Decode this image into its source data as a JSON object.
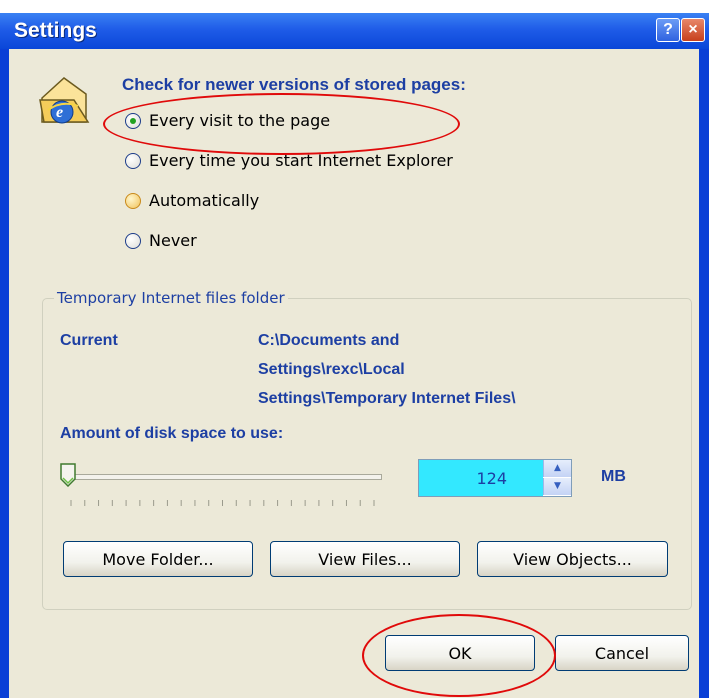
{
  "window": {
    "title": "Settings",
    "help_glyph": "?",
    "close_glyph": "×"
  },
  "check": {
    "heading": "Check for newer versions of stored pages:",
    "options": [
      {
        "label": "Every visit to the page",
        "selected": true
      },
      {
        "label": "Every time you start Internet Explorer",
        "selected": false
      },
      {
        "label": "Automatically",
        "selected": false
      },
      {
        "label": "Never",
        "selected": false
      }
    ]
  },
  "temp_folder": {
    "group_title": "Temporary Internet files folder",
    "current_label": "Current",
    "current_path_lines": [
      "C:\\Documents and",
      "Settings\\rexc\\Local",
      "Settings\\Temporary Internet Files\\"
    ],
    "disk_space_label": "Amount of disk space to use:",
    "slider_value": 0.0,
    "disk_space_value": "124",
    "unit": "MB"
  },
  "buttons": {
    "move_folder": "Move Folder...",
    "view_files": "View Files...",
    "view_objects": "View Objects...",
    "ok": "OK",
    "cancel": "Cancel"
  },
  "colors": {
    "title_bar": "#0a46d8",
    "dialog_bg": "#ece9d8",
    "heading": "#1d3fa3",
    "spin_highlight": "#33e8ff",
    "annotation": "#e00a0a"
  }
}
